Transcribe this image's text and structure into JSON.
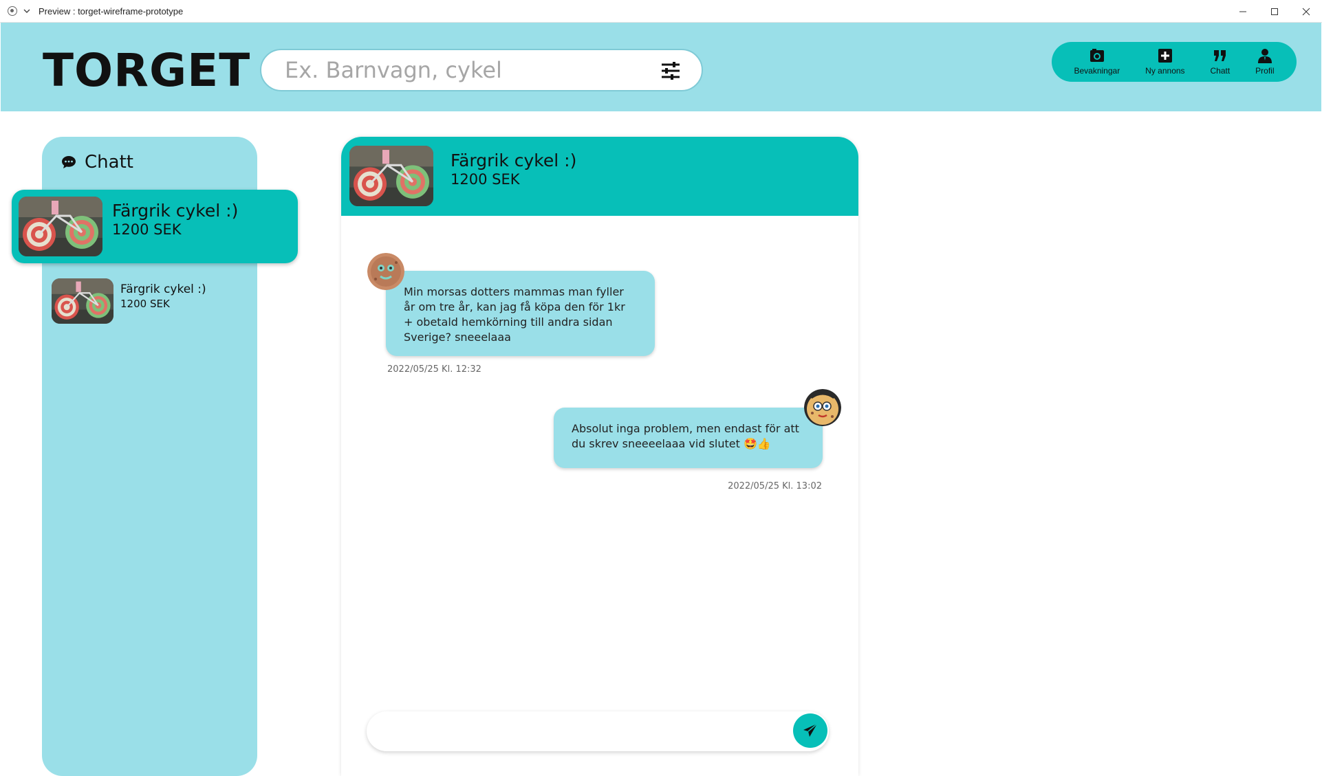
{
  "window": {
    "title": "Preview : torget-wireframe-prototype"
  },
  "header": {
    "logo": "TORGET",
    "search": {
      "placeholder": "Ex. Barnvagn, cykel",
      "value": ""
    },
    "nav": [
      {
        "label": "Bevakningar",
        "icon": "camera-icon"
      },
      {
        "label": "Ny annons",
        "icon": "plus-square-icon"
      },
      {
        "label": "Chatt",
        "icon": "quote-icon"
      },
      {
        "label": "Profil",
        "icon": "user-icon"
      }
    ]
  },
  "sidebar": {
    "title": "Chatt",
    "conversations": [
      {
        "name": "Färgrik cykel :)",
        "price": "1200 SEK",
        "active": true
      },
      {
        "name": "Färgrik cykel :)",
        "price": "1200 SEK",
        "active": false
      }
    ]
  },
  "chat": {
    "header": {
      "name": "Färgrik cykel :)",
      "price": "1200 SEK"
    },
    "messages": [
      {
        "direction": "incoming",
        "text": "Min morsas dotters mammas man fyller år om tre år, kan jag få köpa den för 1kr + obetald hemkörning till andra sidan Sverige? sneeelaaa",
        "timestamp": "2022/05/25 Kl. 12:32"
      },
      {
        "direction": "outgoing",
        "text": "Absolut inga problem, men endast för att du skrev sneeeelaaa vid slutet 🤩👍",
        "timestamp": "2022/05/25 Kl. 13:02"
      }
    ],
    "composer": {
      "placeholder": "",
      "value": ""
    }
  },
  "colors": {
    "header_bg": "#9adfe8",
    "accent": "#07bfb8",
    "bubble_bg": "#9adfe8"
  }
}
